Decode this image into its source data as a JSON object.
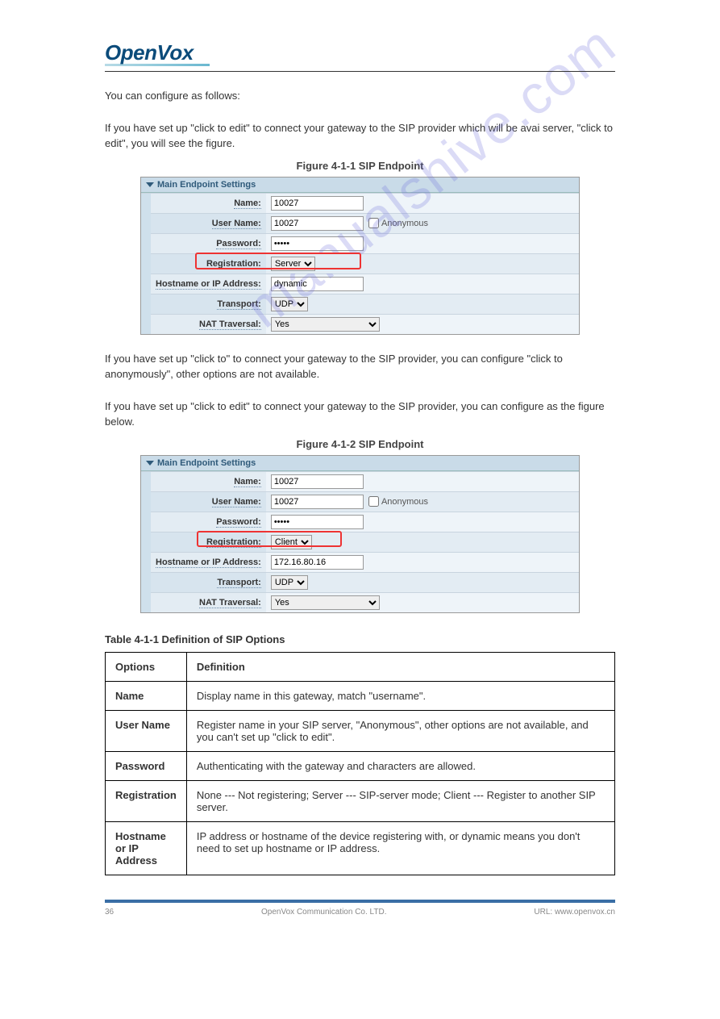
{
  "logo": {
    "open": "Open",
    "vox": "Vox"
  },
  "intro": {
    "p1": "You can configure as follows:",
    "p2a": "If you have set up \"click to edit\" to connect your gateway to the SIP provider which will be avai server, \"click to edit\", you will see the figure.",
    "p2b": ""
  },
  "figures": {
    "f1": {
      "caption": "Figure 4-1-1 SIP Endpoint",
      "panel_title": "Main Endpoint Settings",
      "rows": {
        "name": {
          "label": "Name:",
          "value": "10027"
        },
        "username": {
          "label": "User Name:",
          "value": "10027",
          "anon": "Anonymous"
        },
        "password": {
          "label": "Password:",
          "value": "•••••"
        },
        "registration": {
          "label": "Registration:",
          "value": "Server"
        },
        "hostname": {
          "label": "Hostname or IP Address:",
          "value": "dynamic"
        },
        "transport": {
          "label": "Transport:",
          "value": "UDP"
        },
        "nat": {
          "label": "NAT Traversal:",
          "value": "Yes"
        }
      }
    },
    "mid": {
      "p1": "If you have set up \"click to\" to connect your gateway to the SIP provider, you can configure \"click to anonymously\", other options are not available.",
      "p2": "If you have set up \"click to edit\" to connect your gateway to the SIP provider, you can configure as the figure below."
    },
    "f2": {
      "caption": "Figure 4-1-2 SIP Endpoint",
      "panel_title": "Main Endpoint Settings",
      "rows": {
        "name": {
          "label": "Name:",
          "value": "10027"
        },
        "username": {
          "label": "User Name:",
          "value": "10027",
          "anon": "Anonymous"
        },
        "password": {
          "label": "Password:",
          "value": "•••••"
        },
        "registration": {
          "label": "Registration:",
          "value": "Client"
        },
        "hostname": {
          "label": "Hostname or IP Address:",
          "value": "172.16.80.16"
        },
        "transport": {
          "label": "Transport:",
          "value": "UDP"
        },
        "nat": {
          "label": "NAT Traversal:",
          "value": "Yes"
        }
      }
    }
  },
  "defs": {
    "title": "Table 4-1-1 Definition of SIP Options",
    "headers": {
      "opt": "Options",
      "def": "Definition"
    },
    "rows": [
      {
        "opt": "Name",
        "def": "Display name in this gateway, match \"username\"."
      },
      {
        "opt": "User Name",
        "def": "Register name in your SIP server, \"Anonymous\", other options are not available, and you can't set up \"click to edit\"."
      },
      {
        "opt": "Password",
        "def": "Authenticating with the gateway and characters are allowed."
      },
      {
        "opt": "Registration",
        "def": "None --- Not registering; Server --- SIP-server mode; Client --- Register to another SIP server."
      },
      {
        "opt": "Hostname or IP Address",
        "def": "IP address or hostname of the device registering with, or dynamic means you don't need to set up hostname or IP address."
      }
    ]
  },
  "footer": {
    "left": "OpenVox Communication Co. LTD.",
    "right": "URL: www.openvox.cn",
    "page": "36"
  },
  "watermark": "manualshive.com"
}
